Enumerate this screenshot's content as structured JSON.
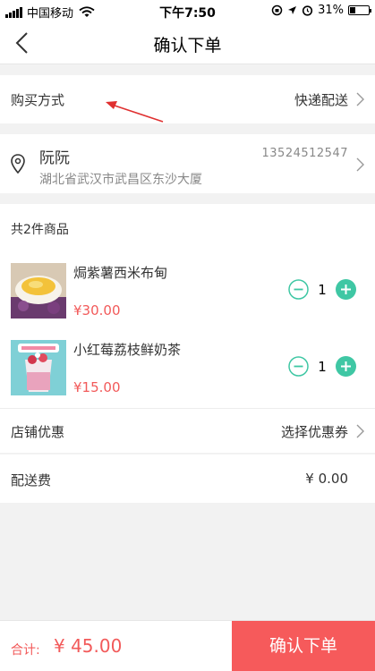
{
  "status_bar": {
    "carrier": "中国移动",
    "time": "下午7:50",
    "battery": "31%",
    "battery_level": 0.31
  },
  "nav": {
    "title": "确认下单",
    "back_icon": "chevron-left-icon"
  },
  "purchase": {
    "label": "购买方式",
    "value": "快递配送"
  },
  "address": {
    "name": "阮阮",
    "phone": "13524512547",
    "address": "湖北省武汉市武昌区东沙大厦",
    "icon": "location-pin-icon"
  },
  "goods": {
    "count_label": "共2件商品",
    "items": [
      {
        "name": "焗紫薯西米布甸",
        "price": "¥30.00",
        "qty": "1"
      },
      {
        "name": "小红莓荔枝鲜奶茶",
        "price": "¥15.00",
        "qty": "1"
      }
    ]
  },
  "coupon": {
    "label": "店铺优惠",
    "value": "选择优惠券"
  },
  "shipping": {
    "label": "配送费",
    "value": "¥ 0.00"
  },
  "footer": {
    "total_label": "合计:",
    "total_value": "¥ 45.00",
    "confirm_label": "确认下单"
  },
  "colors": {
    "accent": "#f65a5b",
    "price": "#f25a5a",
    "stepper": "#3fc7a4"
  }
}
